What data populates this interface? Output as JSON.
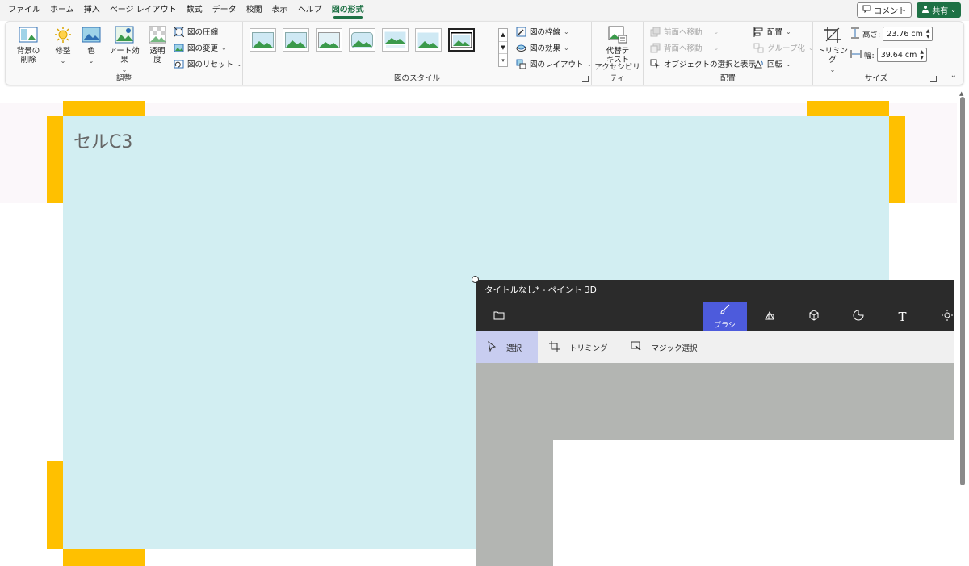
{
  "menu": {
    "tabs": [
      "ファイル",
      "ホーム",
      "挿入",
      "ページ レイアウト",
      "数式",
      "データ",
      "校閲",
      "表示",
      "ヘルプ",
      "図の形式"
    ],
    "active_tab": "図の形式",
    "comment_label": "コメント",
    "share_label": "共有"
  },
  "ribbon": {
    "adjust": {
      "label": "調整",
      "remove_bg_1": "背景の",
      "remove_bg_2": "削除",
      "corrections": "修整",
      "color": "色",
      "art_effects": "アート効果",
      "transparency_1": "透明",
      "transparency_2": "度",
      "compress": "図の圧縮",
      "change": "図の変更",
      "reset": "図のリセット"
    },
    "styles": {
      "label": "図のスタイル",
      "border": "図の枠線",
      "effects": "図の効果",
      "layout": "図のレイアウト"
    },
    "accessibility": {
      "label": "アクセシビリティ",
      "alt_text_1": "代替テ",
      "alt_text_2": "キスト"
    },
    "arrange": {
      "label": "配置",
      "bring_forward": "前面へ移動",
      "send_backward": "背面へ移動",
      "selection_pane": "オブジェクトの選択と表示",
      "align": "配置",
      "group": "グループ化",
      "rotate": "回転"
    },
    "size": {
      "label": "サイズ",
      "crop": "トリミング",
      "height_label": "高さ:",
      "height_value": "23.76 cm",
      "width_label": "幅:",
      "width_value": "39.64 cm"
    }
  },
  "sheet": {
    "picture_text": "セルC3"
  },
  "paint": {
    "title": "タイトルなし* - ペイント 3D",
    "brush_label": "ブラシ",
    "select_label": "選択",
    "crop_label": "トリミング",
    "magic_select_label": "マジック選択"
  },
  "colors": {
    "excel_green": "#1e7145",
    "handle_yellow": "#ffc000",
    "picture_fill": "#d2eef2",
    "paint_dark": "#2b2b2b",
    "paint_accent": "#4d5bdc"
  }
}
